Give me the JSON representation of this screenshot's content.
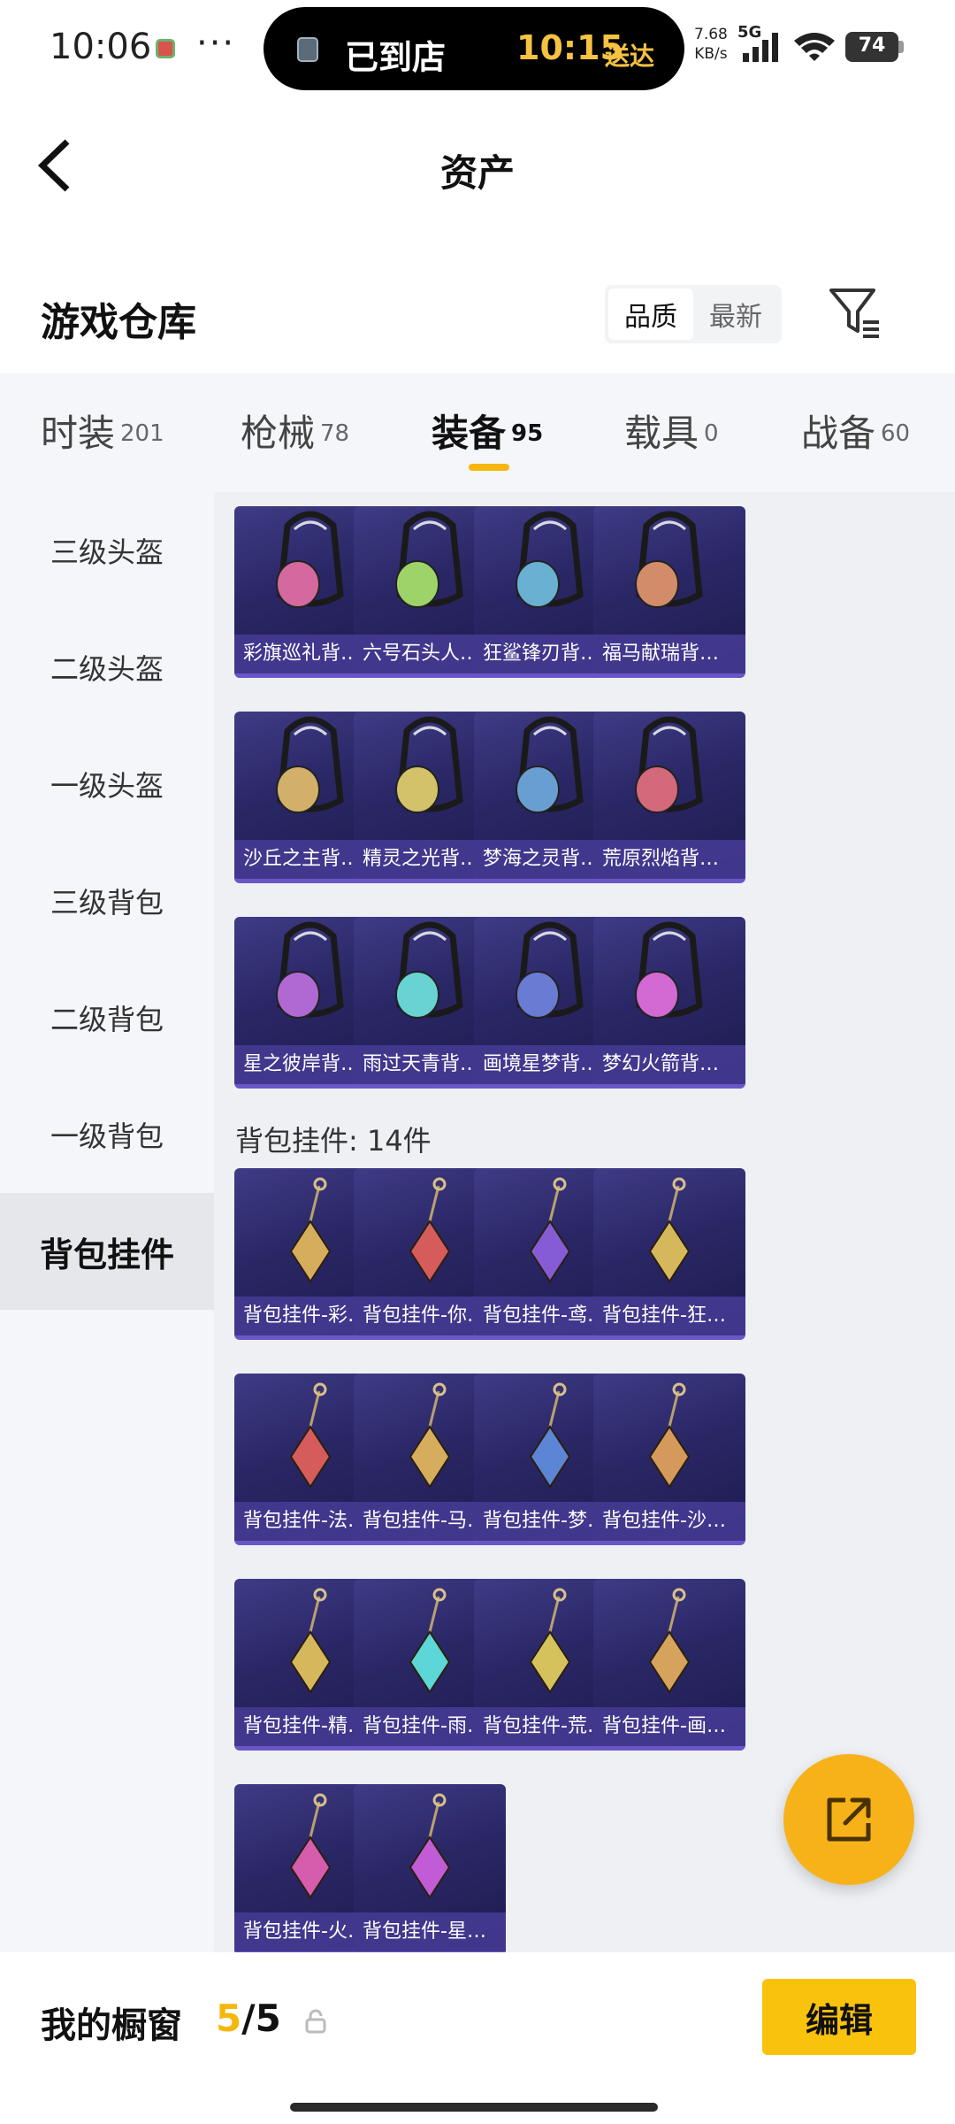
{
  "status_bar": {
    "time": "10:06",
    "more": "···",
    "island_status": "已到店",
    "island_time": "10:15",
    "island_deliver": "送达",
    "net_speed_value": "7.68",
    "net_speed_unit": "KB/s",
    "network": "5G",
    "battery": "74"
  },
  "header": {
    "title": "资产"
  },
  "warehouse": {
    "title": "游戏仓库",
    "sort_options": [
      "品质",
      "最新"
    ],
    "sort_selected": "品质"
  },
  "category_tabs": [
    {
      "label": "时装",
      "count": "201"
    },
    {
      "label": "枪械",
      "count": "78"
    },
    {
      "label": "装备",
      "count": "95"
    },
    {
      "label": "载具",
      "count": "0"
    },
    {
      "label": "战备",
      "count": "60"
    }
  ],
  "active_tab": "装备",
  "sidebar": {
    "items": [
      "三级头盔",
      "二级头盔",
      "一级头盔",
      "三级背包",
      "二级背包",
      "一级背包",
      "背包挂件"
    ],
    "active": "背包挂件"
  },
  "backpacks": [
    {
      "name": "彩旗巡礼背…",
      "icon": "backpack-icon"
    },
    {
      "name": "六号石头人…",
      "icon": "backpack-icon"
    },
    {
      "name": "狂鲨锋刃背…",
      "icon": "backpack-icon"
    },
    {
      "name": "福马献瑞背…",
      "icon": "backpack-icon"
    },
    {
      "name": "沙丘之主背…",
      "icon": "backpack-icon"
    },
    {
      "name": "精灵之光背…",
      "icon": "backpack-icon"
    },
    {
      "name": "梦海之灵背…",
      "icon": "backpack-icon"
    },
    {
      "name": "荒原烈焰背…",
      "icon": "backpack-icon"
    },
    {
      "name": "星之彼岸背…",
      "icon": "backpack-icon"
    },
    {
      "name": "雨过天青背…",
      "icon": "backpack-icon"
    },
    {
      "name": "画境星梦背…",
      "icon": "backpack-icon"
    },
    {
      "name": "梦幻火箭背…",
      "icon": "backpack-icon"
    }
  ],
  "pendants_section": {
    "label": "背包挂件: 14件"
  },
  "pendants": [
    {
      "name": "背包挂件-彩…",
      "icon": "pendant-icon"
    },
    {
      "name": "背包挂件-你…",
      "icon": "pendant-icon"
    },
    {
      "name": "背包挂件-鸢…",
      "icon": "pendant-icon"
    },
    {
      "name": "背包挂件-狂…",
      "icon": "pendant-icon"
    },
    {
      "name": "背包挂件-法…",
      "icon": "pendant-icon"
    },
    {
      "name": "背包挂件-马…",
      "icon": "pendant-icon"
    },
    {
      "name": "背包挂件-梦…",
      "icon": "pendant-icon"
    },
    {
      "name": "背包挂件-沙…",
      "icon": "pendant-icon"
    },
    {
      "name": "背包挂件-精…",
      "icon": "pendant-icon"
    },
    {
      "name": "背包挂件-雨…",
      "icon": "pendant-icon"
    },
    {
      "name": "背包挂件-荒…",
      "icon": "pendant-icon"
    },
    {
      "name": "背包挂件-画…",
      "icon": "pendant-icon"
    },
    {
      "name": "背包挂件-火…",
      "icon": "pendant-icon"
    },
    {
      "name": "背包挂件-星…",
      "icon": "pendant-icon"
    }
  ],
  "bottom_bar": {
    "label": "我的橱窗",
    "count_current": "5",
    "count_sep": "/",
    "count_total": "5",
    "edit_label": "编辑"
  },
  "colors": {
    "accent": "#f5b70c",
    "card_bg": "#2a2766",
    "card_label_bg": "#463c96"
  }
}
